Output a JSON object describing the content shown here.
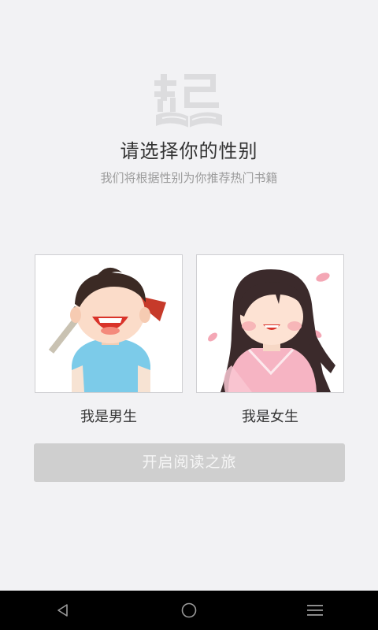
{
  "header": {
    "logo_icon": "qidian-book-logo-icon",
    "title": "请选择你的性别",
    "subtitle": "我们将根据性别为你推荐热门书籍"
  },
  "gender_options": [
    {
      "id": "male",
      "label": "我是男生",
      "illustration": "boy-with-sword-illustration"
    },
    {
      "id": "female",
      "label": "我是女生",
      "illustration": "girl-with-petals-illustration"
    }
  ],
  "start_button": {
    "label": "开启阅读之旅",
    "state": "disabled",
    "color": "#cfcfcf"
  },
  "navbar": {
    "buttons": [
      "back-icon",
      "home-icon",
      "menu-icon"
    ]
  },
  "colors": {
    "background": "#f2f2f4",
    "title": "#333333",
    "subtitle": "#9b9b9b",
    "boy_shirt": "#7ccbe9",
    "girl_dress": "#f6b4c3"
  }
}
